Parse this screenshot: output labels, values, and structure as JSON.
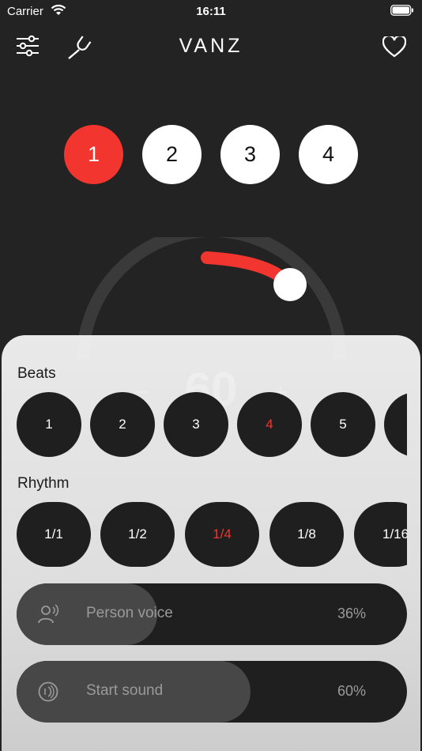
{
  "status_bar": {
    "carrier": "Carrier",
    "time": "16:11"
  },
  "header": {
    "title": "VANZ"
  },
  "accent_color": "#f2352e",
  "top_beats": [
    {
      "label": "1",
      "active": true
    },
    {
      "label": "2",
      "active": false
    },
    {
      "label": "3",
      "active": false
    },
    {
      "label": "4",
      "active": false
    }
  ],
  "tempo": {
    "minus": "−",
    "value": "60",
    "plus": "+"
  },
  "panel": {
    "beats_label": "Beats",
    "beats": [
      "1",
      "2",
      "3",
      "4",
      "5",
      ""
    ],
    "beats_selected": "4",
    "rhythm_label": "Rhythm",
    "rhythms": [
      "1/1",
      "1/2",
      "1/4",
      "1/8",
      "1/16"
    ],
    "rhythm_selected": "1/4",
    "person_voice": {
      "label": "Person voice",
      "value_text": "36%",
      "level": 0.36
    },
    "start_sound": {
      "label": "Start sound",
      "value_text": "60%",
      "level": 0.6
    }
  }
}
